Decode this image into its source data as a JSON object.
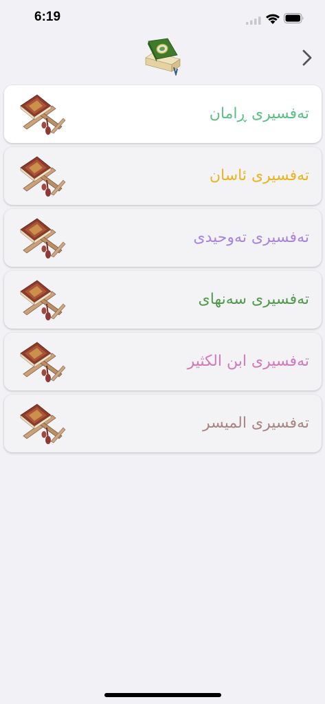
{
  "status_bar": {
    "time": "6:19",
    "icons": [
      "cellular-signal-icon",
      "wifi-icon",
      "battery-icon"
    ]
  },
  "nav_bar": {
    "logo_icon": "quran-book-icon",
    "forward_icon": "chevron-right-icon"
  },
  "tafsir_list": [
    {
      "label": "تەفسیری ڕامان",
      "color": "#5dbf84",
      "icon": "quran-stand-icon",
      "selected": true
    },
    {
      "label": "تەفسیری ئاسان",
      "color": "#e8b520",
      "icon": "quran-stand-icon",
      "selected": false
    },
    {
      "label": "تەفسیری تەوحیدی",
      "color": "#a784e0",
      "icon": "quran-stand-icon",
      "selected": false
    },
    {
      "label": "تەفسیری سەنهای",
      "color": "#4f9a4b",
      "icon": "quran-stand-icon",
      "selected": false
    },
    {
      "label": "تەفسیری ابن الكثير",
      "color": "#d07ab9",
      "icon": "quran-stand-icon",
      "selected": false
    },
    {
      "label": "تەفسیری المیسر",
      "color": "#a88583",
      "icon": "quran-stand-icon",
      "selected": false
    }
  ]
}
